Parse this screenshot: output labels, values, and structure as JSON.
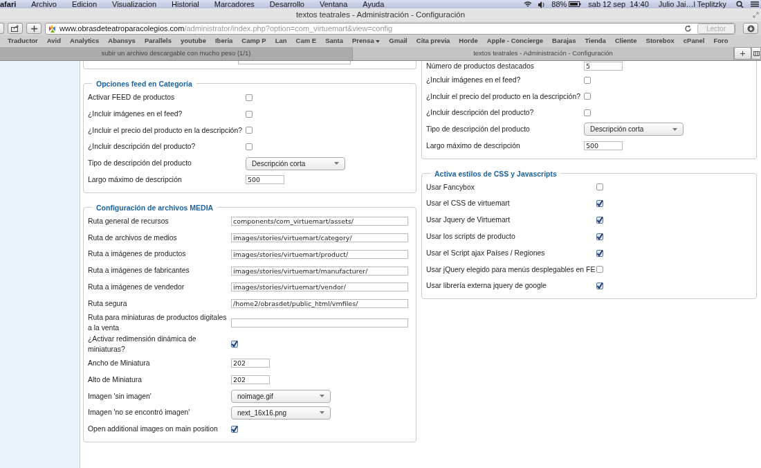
{
  "menubar": {
    "app": "afari",
    "items": [
      "Archivo",
      "Edicion",
      "Visualizacion",
      "Historial",
      "Marcadores",
      "Desarrollo",
      "Ventana",
      "Ayuda"
    ],
    "battery": "88%",
    "datetime": "sab 12 sep  14:40",
    "user": "Julio Jai…l Teplitzky"
  },
  "window": {
    "title": "textos teatrales - Administración - Configuración"
  },
  "address_bar": {
    "domain": "www.obrasdeteatroparacolegios.com",
    "path": "/administrator/index.php?option=com_virtuemart&view=config",
    "reader_button": "Lector"
  },
  "bookmarks": [
    {
      "label": "Traductor",
      "kind": "link"
    },
    {
      "label": "Avid",
      "kind": "link"
    },
    {
      "label": "Analytics",
      "kind": "link"
    },
    {
      "label": "Abansys",
      "kind": "link"
    },
    {
      "label": "Parallels",
      "kind": "link"
    },
    {
      "label": "youtube",
      "kind": "link"
    },
    {
      "label": "Iberia",
      "kind": "link"
    },
    {
      "label": "Camp P",
      "kind": "link"
    },
    {
      "label": "Lan",
      "kind": "link"
    },
    {
      "label": "Cam E",
      "kind": "link"
    },
    {
      "label": "Santa",
      "kind": "link"
    },
    {
      "label": "Prensa",
      "kind": "folder"
    },
    {
      "label": "Gmail",
      "kind": "link"
    },
    {
      "label": "Cita previa",
      "kind": "link"
    },
    {
      "label": "Horde",
      "kind": "link"
    },
    {
      "label": "Apple - Concierge",
      "kind": "link"
    },
    {
      "label": "Barajas",
      "kind": "link"
    },
    {
      "label": "Tienda",
      "kind": "link"
    },
    {
      "label": "Cliente",
      "kind": "link"
    },
    {
      "label": "Storebox",
      "kind": "link"
    },
    {
      "label": "cPanel",
      "kind": "link"
    },
    {
      "label": "Foro",
      "kind": "link"
    }
  ],
  "tabs": [
    {
      "title": "subir un archivo descargable con mucho peso (1/1)",
      "selected": false
    },
    {
      "title": "textos teatrales - Administración - Configuración",
      "selected": true
    }
  ],
  "left_panels": [
    {
      "rows": [
        {
          "kind": "text_short",
          "value": ""
        }
      ]
    },
    {
      "legend": "Opciones feed en Categoría",
      "rows": [
        {
          "kind": "checkbox",
          "label": "Activar FEED de productos",
          "checked": false
        },
        {
          "kind": "checkbox",
          "label": "¿Incluir imágenes en el feed?",
          "checked": false
        },
        {
          "kind": "checkbox",
          "label": "¿Incluir el precio del producto en la descripción?",
          "checked": false
        },
        {
          "kind": "checkbox",
          "label": "¿Incluir descripción del producto?",
          "checked": false
        },
        {
          "kind": "select",
          "label": "Tipo de descripción del producto",
          "value": "Descripción corta"
        },
        {
          "kind": "text_short",
          "label": "Largo máximo de descripción",
          "value": "500"
        }
      ]
    },
    {
      "legend": "Configuración de archivos MEDIA",
      "rows": [
        {
          "kind": "text",
          "label": "Ruta general de recursos",
          "value": "components/com_virtuemart/assets/"
        },
        {
          "kind": "text",
          "label": "Ruta de archivos de medios",
          "value": "images/stories/virtuemart/category/"
        },
        {
          "kind": "text",
          "label": "Ruta a imágenes de productos",
          "value": "images/stories/virtuemart/product/"
        },
        {
          "kind": "text",
          "label": "Ruta a imágenes de fabricantes",
          "value": "images/stories/virtuemart/manufacturer/"
        },
        {
          "kind": "text",
          "label": "Ruta a imágenes de vendedor",
          "value": "images/stories/virtuemart/vendor/"
        },
        {
          "kind": "text",
          "label": "Ruta segura",
          "value": "/home2/obrasdet/public_html/vmfiles/"
        },
        {
          "kind": "text",
          "label": "Ruta para miniaturas de productos digitales a la venta",
          "value": ""
        },
        {
          "kind": "checkbox",
          "label": "¿Activar redimensión dinámica de miniaturas?",
          "checked": true
        },
        {
          "kind": "text_short",
          "label": "Ancho de Miniatura",
          "value": "202"
        },
        {
          "kind": "text_short",
          "label": "Alto de Miniatura",
          "value": "202"
        },
        {
          "kind": "select",
          "label": "Imagen 'sin imagen'",
          "value": "noimage.gif"
        },
        {
          "kind": "select",
          "label": "Imagen 'no se encontró imagen'",
          "value": "next_16x16.png"
        },
        {
          "kind": "checkbox",
          "label": "Open additional images on main position",
          "checked": true
        }
      ]
    }
  ],
  "right_panels": [
    {
      "rows": [
        {
          "kind": "text_short",
          "label": "Número de productos destacados",
          "value": "5"
        },
        {
          "kind": "checkbox",
          "label": "¿Incluir imágenes en el feed?",
          "checked": false
        },
        {
          "kind": "checkbox",
          "label": "¿Incluir el precio del producto en la descripción?",
          "checked": false
        },
        {
          "kind": "checkbox",
          "label": "¿Incluir descripción del producto?",
          "checked": false
        },
        {
          "kind": "select",
          "label": "Tipo de descripción del producto",
          "value": "Descripción corta"
        },
        {
          "kind": "text_short",
          "label": "Largo máximo de descripción",
          "value": "500"
        }
      ]
    },
    {
      "legend": "Activa estilos de CSS y Javascripts",
      "rows": [
        {
          "kind": "checkbox",
          "label": "Usar Fancybox",
          "checked": false
        },
        {
          "kind": "checkbox",
          "label": "Usar el CSS de virtuemart",
          "checked": true
        },
        {
          "kind": "checkbox",
          "label": "Usar Jquery de Virtuemart",
          "checked": true
        },
        {
          "kind": "checkbox",
          "label": "Usar los scripts de producto",
          "checked": true
        },
        {
          "kind": "checkbox",
          "label": "Usar el Script ajax Países / Regiones",
          "checked": true
        },
        {
          "kind": "checkbox",
          "label": "Usar jQuery elegido para menús desplegables en FE",
          "checked": false
        },
        {
          "kind": "checkbox",
          "label": "Usar librería externa jquery de google",
          "checked": true
        }
      ]
    }
  ]
}
